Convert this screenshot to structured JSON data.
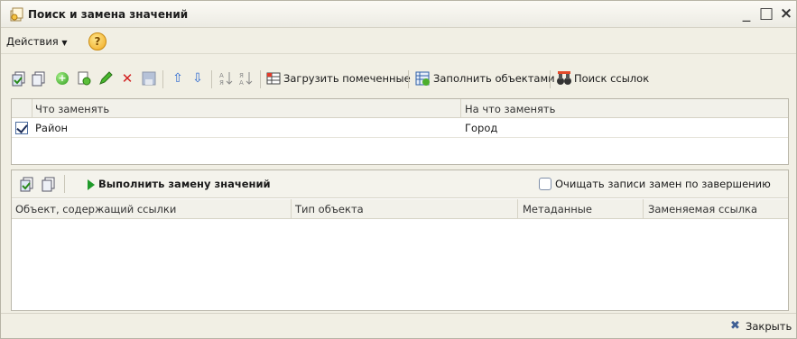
{
  "window": {
    "title": "Поиск и замена значений",
    "controls": [
      "_",
      "□",
      "×"
    ]
  },
  "menu": {
    "actions_label": "Действия",
    "help_label": "?"
  },
  "toolbar": {
    "load_marked_label": "Загрузить помеченные",
    "fill_objects_label": "Заполнить объектами",
    "find_links_label": "Поиск ссылок",
    "sort_asc_label": "А\nЯ",
    "sort_desc_label": "Я\nА"
  },
  "replace_table": {
    "columns": [
      "Что заменять",
      "На что заменять"
    ],
    "rows": [
      {
        "checked": true,
        "what": "Район",
        "to": "Город"
      }
    ]
  },
  "exec_toolbar": {
    "exec_label": "Выполнить замену значений",
    "clear_label": "Очищать записи замен по завершению"
  },
  "results_table": {
    "columns": [
      "Объект, содержащий ссылки",
      "Тип объекта",
      "Метаданные",
      "Заменяемая ссылка"
    ]
  },
  "footer": {
    "close_label": "Закрыть"
  },
  "colors": {
    "window_bg": "#f1efe4",
    "accent_blue": "#3f5f94",
    "play_green": "#1f9a2a",
    "delete_red": "#d22020"
  }
}
